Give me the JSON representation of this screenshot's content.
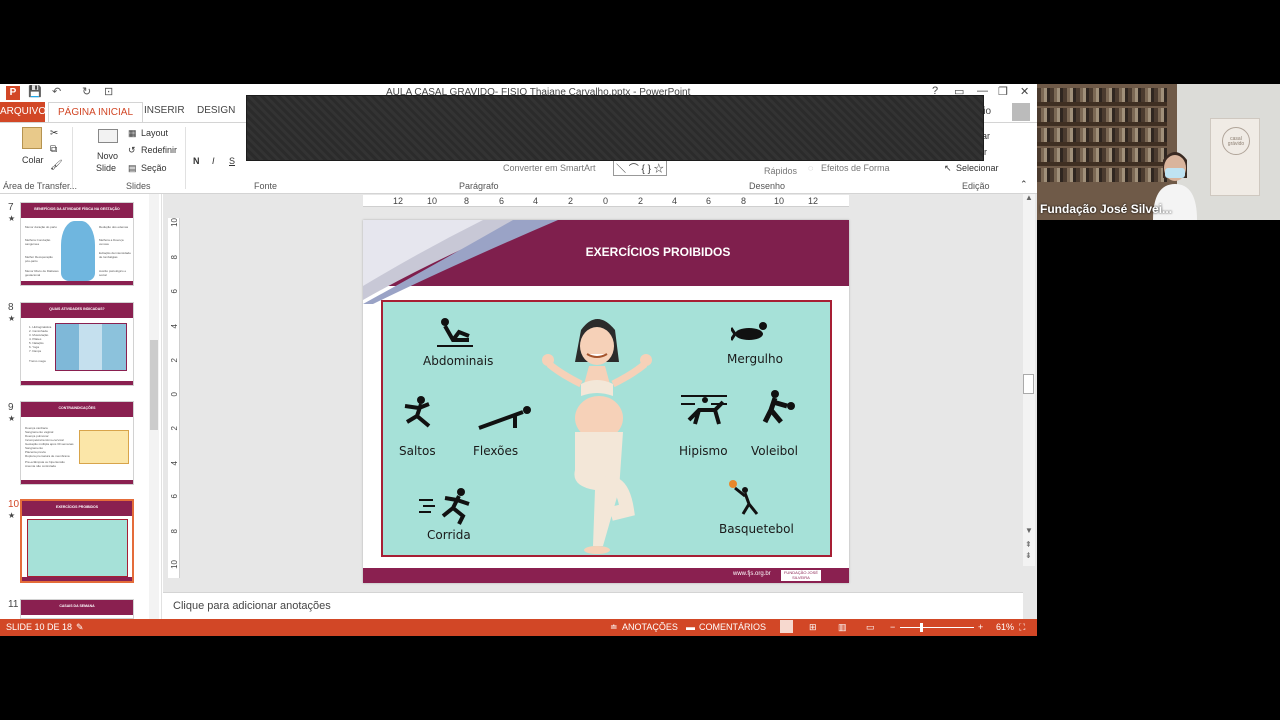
{
  "window": {
    "title": "AULA CASAL GRAVIDO- FISIO Thaiane Carvalho.pptx - PowerPoint",
    "app_icon": "P",
    "account_name": "rio",
    "controls": [
      "?",
      "▭",
      "—",
      "❐",
      "✕"
    ]
  },
  "tabs": {
    "file": "ARQUIVO",
    "home": "PÁGINA INICIAL",
    "insert": "INSERIR",
    "design": "DESIGN"
  },
  "ribbon": {
    "paste": "Colar",
    "new_slide_1": "Novo",
    "new_slide_2": "Slide",
    "layout": "Layout",
    "reset": "Redefinir",
    "section": "Seção",
    "bold": "N",
    "italic": "I",
    "underline": "S",
    "strike": "S",
    "convert_smartart": "Converter em SmartArt",
    "quick_styles": "Rápidos",
    "shape_effects": "Efeitos de Forma",
    "select": "Selecionar",
    "replace": "ir",
    "find": "ar",
    "groups": {
      "clipboard": "Área de Transfer...",
      "slides": "Slides",
      "font": "Fonte",
      "paragraph": "Parágrafo",
      "drawing": "Desenho",
      "editing": "Edição"
    }
  },
  "thumbnails": [
    {
      "num": "7",
      "title": "BENEFÍCIOS DA ATIVIDADE FÍSICA NA GESTAÇÃO",
      "lines_left": [
        "Menor duração do parto",
        "Melhora Condução sanguínea",
        "Melhor Recuperação pós-parto",
        "Menor Risco de Diabetes gestacional"
      ],
      "lines_right": [
        "Redução dos edemas",
        "Melhora a Doença venosa",
        "Evitação da intensidade de lombalgias",
        "Auxílio psicológico e social"
      ]
    },
    {
      "num": "8",
      "title": "QUAIS ATIVIDADES INDICADAS?",
      "lines_left": [
        "1. Hidroginástica",
        "2. Caminhada",
        "3. Musculação",
        "4. Pilates",
        "5. Natação",
        "6. Yoga",
        "7. Dança",
        "Treino mega"
      ],
      "lines_right": []
    },
    {
      "num": "9",
      "title": "CONTRAINDICAÇÕES",
      "lines_left": [
        "Doença cardíaca",
        "Sangramento vaginal",
        "Doença pulmonar",
        "Incompetência istmo-cervical",
        "Gestação múltipla após 30 semanas",
        "Sangramento",
        "Placenta prévia",
        "Ruptura prematura de membrana",
        "Pré-eclâmpsia ou hipertensão",
        "Anemia não controlada"
      ],
      "lines_right": []
    },
    {
      "num": "10",
      "title": "EXERCÍCIOS PROIBIDOS",
      "lines_left": [],
      "lines_right": []
    },
    {
      "num": "11",
      "title": "CASAIS DA SEMANA",
      "lines_left": [],
      "lines_right": []
    }
  ],
  "ruler": {
    "h": [
      "12",
      "10",
      "8",
      "6",
      "4",
      "2",
      "0",
      "2",
      "4",
      "6",
      "8",
      "10",
      "12"
    ],
    "v": [
      "10",
      "8",
      "6",
      "4",
      "2",
      "0",
      "2",
      "4",
      "6",
      "8",
      "10"
    ]
  },
  "slide": {
    "title": "EXERCÍCIOS PROIBIDOS",
    "exercises": [
      {
        "label": "Abdominais",
        "icon": "situp-icon"
      },
      {
        "label": "Mergulho",
        "icon": "diving-icon"
      },
      {
        "label": "Saltos",
        "icon": "jump-icon"
      },
      {
        "label": "Flexões",
        "icon": "pushup-icon"
      },
      {
        "label": "Hipismo",
        "icon": "horse-riding-icon"
      },
      {
        "label": "Voleibol",
        "icon": "volleyball-icon"
      },
      {
        "label": "Corrida",
        "icon": "running-icon"
      },
      {
        "label": "Basquetebol",
        "icon": "basketball-icon"
      }
    ],
    "footer_url": "www.fjs.org.br",
    "footer_logo": "FUNDAÇÃO JOSÉ SILVEIRA"
  },
  "notes_placeholder": "Clique para adicionar anotações",
  "status": {
    "slide_counter": "SLIDE 10 DE 18",
    "notes": "ANOTAÇÕES",
    "comments": "COMENTÁRIOS",
    "zoom": "61%",
    "zoom_level": 0.61
  },
  "video": {
    "participant_name": "Fundação José Silvei...",
    "banner_text": "casal grávido"
  },
  "colors": {
    "accent": "#d24726",
    "slide_header": "#7f1f4d",
    "illustration_bg": "#a6e1d8",
    "frame_border": "#a71e34"
  }
}
